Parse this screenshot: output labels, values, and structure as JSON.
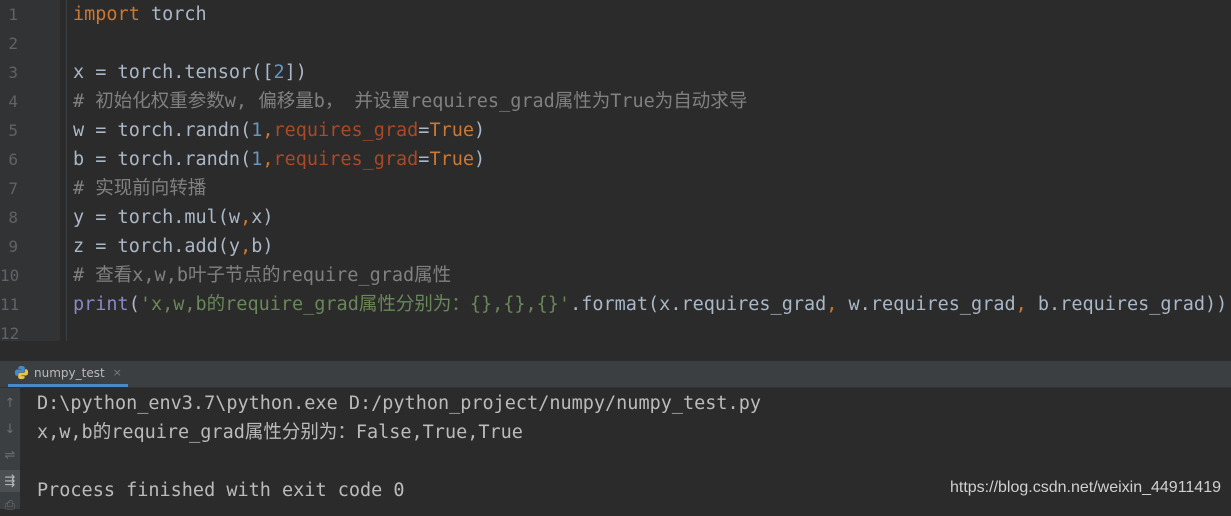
{
  "editor": {
    "line_numbers": [
      "1",
      "2",
      "3",
      "4",
      "5",
      "6",
      "7",
      "8",
      "9",
      "10",
      "11",
      "12"
    ],
    "lines": {
      "l1": {
        "kw": "import",
        "rest": " torch"
      },
      "l3": {
        "a": "x = torch.tensor([",
        "num": "2",
        "b": "])"
      },
      "l4": {
        "comment": "# 初始化权重参数w, 偏移量b， 并设置requires_grad属性为True为自动求导"
      },
      "l5": {
        "a": "w = torch.randn(",
        "num": "1",
        "comma": ",",
        "param": "requires_grad",
        "eq": "=",
        "kw": "True",
        "b": ")"
      },
      "l6": {
        "a": "b = torch.randn(",
        "num": "1",
        "comma": ",",
        "param": "requires_grad",
        "eq": "=",
        "kw": "True",
        "b": ")"
      },
      "l7": {
        "comment": "# 实现前向转播"
      },
      "l8": {
        "a": "y = torch.mul(w",
        "comma": ",",
        "b": "x)"
      },
      "l9": {
        "a": "z = torch.add(y",
        "comma": ",",
        "b": "b)"
      },
      "l10": {
        "comment": "# 查看x,w,b叶子节点的require_grad属性"
      },
      "l11": {
        "print": "print",
        "open": "(",
        "str": "'x,w,b的require_grad属性分别为：{},{},{}'",
        "fmt": ".format(x.requires_grad",
        "c1": ",",
        "mid": " w.requires_grad",
        "c2": ",",
        "end": " b.requires_grad))"
      }
    }
  },
  "run_panel": {
    "tab_label": "numpy_test",
    "tab_close": "×",
    "tools": [
      "↑",
      "↓",
      "⇌",
      "⇶",
      "⎙"
    ],
    "output": [
      "D:\\python_env3.7\\python.exe D:/python_project/numpy/numpy_test.py",
      "x,w,b的require_grad属性分别为：False,True,True",
      "",
      "Process finished with exit code 0"
    ],
    "watermark": "https://blog.csdn.net/weixin_44911419"
  },
  "colors": {
    "background": "#2b2b2b",
    "keyword": "#cc7832",
    "number": "#6897bb",
    "string": "#6a8759",
    "comment": "#808080",
    "param": "#aa4926"
  }
}
